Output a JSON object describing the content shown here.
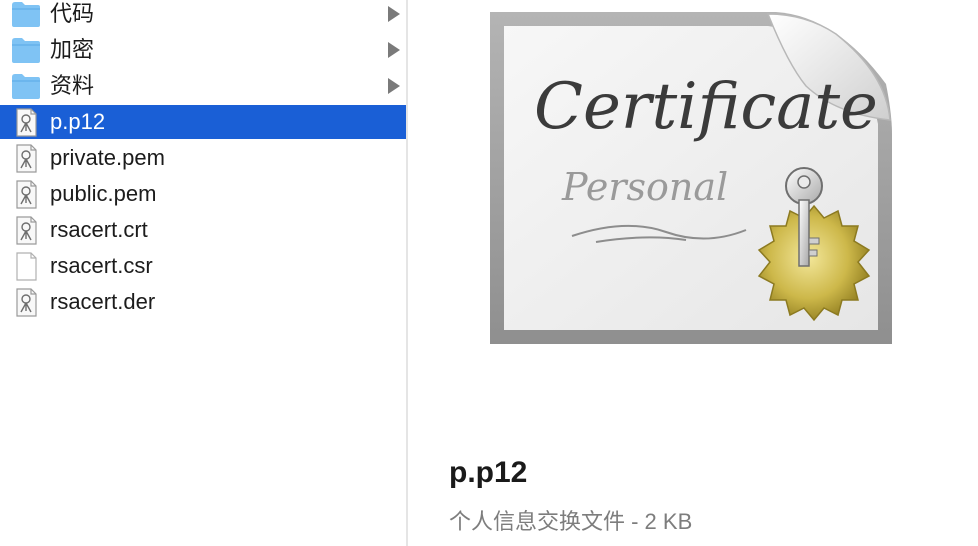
{
  "files": [
    {
      "name": "代码",
      "kind": "folder",
      "icon": "folder-icon",
      "expandable": true,
      "selected": false
    },
    {
      "name": "加密",
      "kind": "folder",
      "icon": "folder-icon",
      "expandable": true,
      "selected": false
    },
    {
      "name": "资料",
      "kind": "folder",
      "icon": "folder-icon",
      "expandable": true,
      "selected": false
    },
    {
      "name": "p.p12",
      "kind": "cert",
      "icon": "certificate-file-icon",
      "expandable": false,
      "selected": true
    },
    {
      "name": "private.pem",
      "kind": "cert",
      "icon": "certificate-file-icon",
      "expandable": false,
      "selected": false
    },
    {
      "name": "public.pem",
      "kind": "cert",
      "icon": "certificate-file-icon",
      "expandable": false,
      "selected": false
    },
    {
      "name": "rsacert.crt",
      "kind": "cert",
      "icon": "certificate-file-icon",
      "expandable": false,
      "selected": false
    },
    {
      "name": "rsacert.csr",
      "kind": "doc",
      "icon": "blank-document-icon",
      "expandable": false,
      "selected": false
    },
    {
      "name": "rsacert.der",
      "kind": "cert",
      "icon": "certificate-file-icon",
      "expandable": false,
      "selected": false
    }
  ],
  "preview": {
    "icon": "personal-certificate-icon",
    "art_title": "Certificate",
    "art_subtitle": "Personal",
    "filename": "p.p12",
    "description": "个人信息交换文件 - 2 KB"
  },
  "colors": {
    "selection": "#1a5fd6",
    "folder": "#7fc3f4",
    "secondary_text": "#7d7d7d"
  }
}
